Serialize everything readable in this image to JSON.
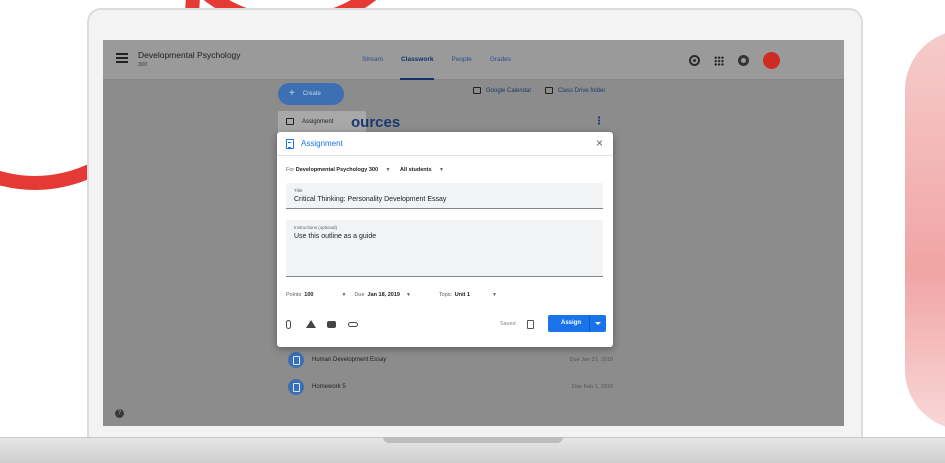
{
  "app": {
    "course_title": "Developmental Psychology",
    "course_sub": "300",
    "tabs": [
      "Stream",
      "Classwork",
      "People",
      "Grades"
    ],
    "active_tab": "Classwork",
    "icons": [
      "settings-gear-icon",
      "apps-grid-icon",
      "account-ring-icon",
      "profile-avatar"
    ],
    "colors": {
      "accent": "#1a73e8",
      "avatar": "#cf2b22"
    }
  },
  "classwork": {
    "create_label": "Create",
    "create_icon": "+",
    "google_calendar": "Google Calendar",
    "class_drive": "Class Drive  folder",
    "menu_item": "Assignment",
    "section_title": "ources",
    "items": [
      {
        "title": "Human Development Essay",
        "due": "Due Jan 21, 2019"
      },
      {
        "title": "Homework 5",
        "due": "Due Feb 1, 2019"
      }
    ]
  },
  "modal": {
    "title": "Assignment",
    "close": "×",
    "for_label": "For",
    "for_course": "Developmental Psychology 300",
    "students": "All students",
    "title_label": "Title",
    "title_value": "Critical Thinking: Personality Development Essay",
    "instructions_label": "Instructions (optional)",
    "instructions_value": "Use this outline as a guide",
    "points_label": "Points",
    "points_value": "100",
    "due_label": "Due",
    "due_value": "Jan 18, 2019",
    "topic_label": "Topic",
    "topic_value": "Unit 1",
    "saved": "Saved",
    "assign": "Assign"
  }
}
